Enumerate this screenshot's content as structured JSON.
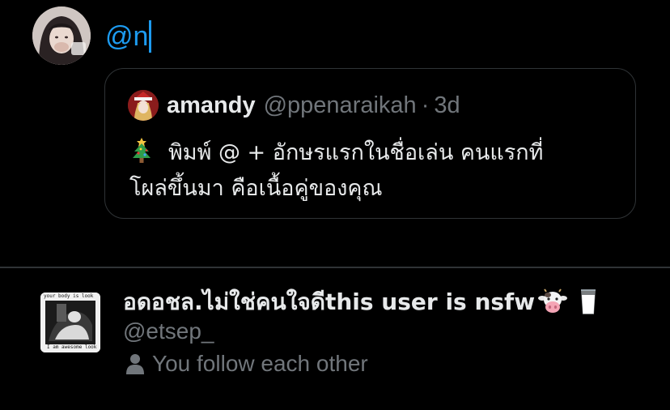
{
  "composer": {
    "input_value": "@n"
  },
  "quoted_tweet": {
    "display_name": "amandy",
    "handle": "@ppenaraikah",
    "separator": "·",
    "time": "3d",
    "text_line1": "พิมพ์ @ + อักษรแรกในชื่อเล่น คนแรกที่",
    "text_line2": "โผล่ขึ้นมา คือเนื้อคู่ของคุณ",
    "leading_icon": "christmas-tree-icon"
  },
  "suggestion": {
    "display_name": "อดอชล.ไม่ใช่คนใจดีthis user is nsfw",
    "handle": "@etsep_",
    "relationship": "You follow each other",
    "avatar_text_top": "your body is look",
    "avatar_text_bottom": "I am awesome look",
    "name_icons": [
      "cow-face-icon",
      "glass-of-milk-icon"
    ],
    "meta_icon": "person-icon"
  },
  "colors": {
    "background": "#000000",
    "accent": "#1d9bf0",
    "primary_text": "#e7e9ea",
    "secondary_text": "#71767b",
    "border": "#2f3336"
  }
}
